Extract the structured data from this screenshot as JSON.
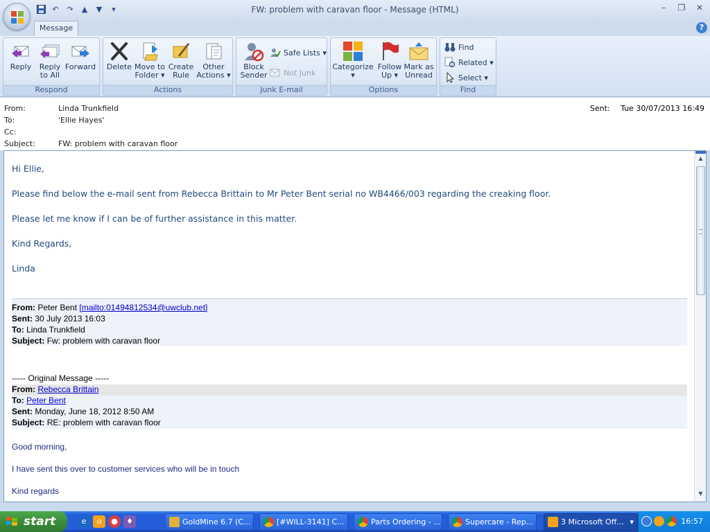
{
  "window": {
    "title": "FW: problem with caravan floor - Message (HTML)"
  },
  "ribbon": {
    "tab": "Message",
    "groups": {
      "respond": "Respond",
      "actions": "Actions",
      "junk": "Junk E-mail",
      "options": "Options",
      "find": "Find"
    },
    "buttons": {
      "reply": "Reply",
      "reply_all_1": "Reply",
      "reply_all_2": "to All",
      "forward": "Forward",
      "delete": "Delete",
      "move_1": "Move to",
      "move_2": "Folder ▾",
      "rule_1": "Create",
      "rule_2": "Rule",
      "other_1": "Other",
      "other_2": "Actions ▾",
      "block_1": "Block",
      "block_2": "Sender",
      "safe_lists": "Safe Lists ▾",
      "not_junk": "Not Junk",
      "categorize_1": "Categorize",
      "categorize_2": "▾",
      "follow_1": "Follow",
      "follow_2": "Up ▾",
      "unread_1": "Mark as",
      "unread_2": "Unread",
      "find": "Find",
      "related": "Related ▾",
      "select": "Select ▾"
    }
  },
  "header": {
    "from_label": "From:",
    "from": "Linda Trunkfield",
    "to_label": "To:",
    "to": "'Ellie Hayes'",
    "cc_label": "Cc:",
    "subject_label": "Subject:",
    "subject": "FW: problem with caravan floor",
    "sent_label": "Sent:",
    "sent": "Tue 30/07/2013 16:49"
  },
  "body": {
    "greeting": "Hi Ellie,",
    "line1": "Please find below the e-mail sent from Rebecca Brittain to Mr Peter Bent serial no WB4466/003 regarding the creaking floor.",
    "line2": "Please let me know if I can be of further assistance in this matter.",
    "regards": "Kind Regards,",
    "sign": "Linda",
    "fw": {
      "from_label": "From:",
      "from_name": "Peter Bent",
      "from_link": "[mailto:01494812534@uwclub.net]",
      "sent_label": "Sent:",
      "sent": "30 July 2013 16:03",
      "to_label": "To:",
      "to": "Linda Trunkfield",
      "subject_label": "Subject:",
      "subject": "Fw: problem with caravan floor"
    },
    "orig": {
      "divider": "----- Original Message -----",
      "from_label": "From:",
      "from": "Rebecca Brittain",
      "to_label": "To:",
      "to": "Peter Bent",
      "sent_label": "Sent:",
      "sent": "Monday, June 18, 2012 8:50 AM",
      "subject_label": "Subject:",
      "subject": "RE: problem with caravan floor",
      "greeting": "Good morning,",
      "line1": "I have sent this over to customer services who will be in touch",
      "regards": "Kind regards"
    }
  },
  "taskbar": {
    "start": "start",
    "tasks": [
      "GoldMine 6.7 (C...",
      "[#WILL-3141] C...",
      "Parts Ordering - ...",
      "Supercare - Rep...",
      "3 Microsoft Off..."
    ],
    "clock": "16:57"
  },
  "colors": {
    "accent": "#245edb",
    "body_text": "#1f497d",
    "link": "#0000cc"
  }
}
